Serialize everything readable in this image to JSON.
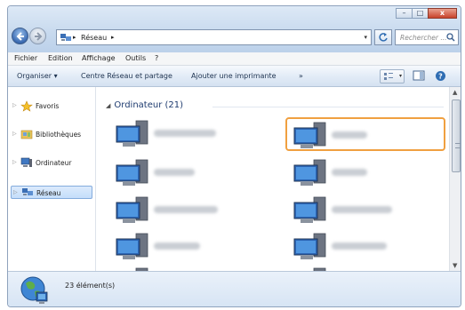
{
  "window": {
    "controls": {
      "minimize": "–",
      "maximize": "□",
      "close": "x"
    }
  },
  "address": {
    "crumb": "Réseau",
    "separator": "▸",
    "dropdown": "▾"
  },
  "search": {
    "placeholder": "Rechercher ..."
  },
  "menubar": [
    "Fichier",
    "Edition",
    "Affichage",
    "Outils",
    "?"
  ],
  "commandbar": {
    "organize": "Organiser ▾",
    "network_center": "Centre Réseau et partage",
    "add_printer": "Ajouter une imprimante",
    "more": "»"
  },
  "nav": {
    "items": [
      {
        "label": "Favoris",
        "icon": "star-icon"
      },
      {
        "label": "Bibliothèques",
        "icon": "libraries-icon"
      },
      {
        "label": "Ordinateur",
        "icon": "computer-icon"
      },
      {
        "label": "Réseau",
        "icon": "network-icon"
      }
    ]
  },
  "content": {
    "group_label": "Ordinateur (21)",
    "items_count_visible": 10
  },
  "status": {
    "count": "23 élément(s)"
  },
  "colors": {
    "highlight": "#f0a040",
    "selected_nav": "#c4ddfa",
    "group_header": "#1e3b6f"
  }
}
